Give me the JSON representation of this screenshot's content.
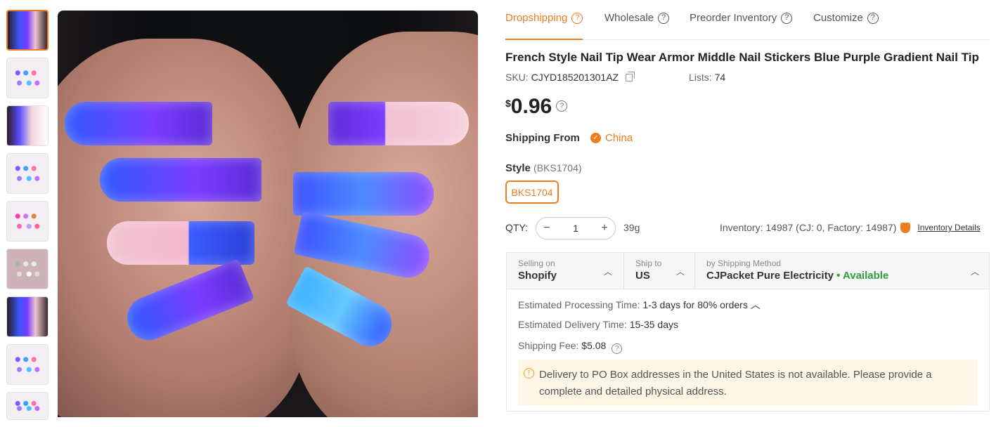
{
  "tabs": [
    {
      "label": "Dropshipping",
      "active": true
    },
    {
      "label": "Wholesale",
      "active": false
    },
    {
      "label": "Preorder Inventory",
      "active": false
    },
    {
      "label": "Customize",
      "active": false
    }
  ],
  "product": {
    "title": "French Style Nail Tip Wear Armor Middle Nail Stickers Blue Purple Gradient Nail Tip",
    "sku_label": "SKU:",
    "sku": "CJYD185201301AZ",
    "lists_label": "Lists:",
    "lists": "74",
    "currency": "$",
    "price": "0.96"
  },
  "shipping_from": {
    "label": "Shipping From",
    "value": "China"
  },
  "style": {
    "label": "Style",
    "selected": "(BKS1704)",
    "options": [
      "BKS1704"
    ]
  },
  "quantity": {
    "label": "QTY:",
    "value": "1",
    "weight": "39g"
  },
  "inventory": {
    "text": "Inventory: 14987 (CJ: 0, Factory: 14987)",
    "link": "Inventory Details"
  },
  "shipping": {
    "selling_on_label": "Selling on",
    "selling_on": "Shopify",
    "ship_to_label": "Ship to",
    "ship_to": "US",
    "method_label": "by Shipping Method",
    "method": "CJPacket Pure Electricity",
    "availability": "• Available",
    "processing_label": "Estimated Processing Time:",
    "processing": "1-3 days for 80% orders",
    "delivery_label": "Estimated Delivery Time:",
    "delivery": "15-35 days",
    "fee_label": "Shipping Fee:",
    "fee": "$5.08",
    "warning": "Delivery to PO Box addresses in the United States is not available. Please provide a complete and detailed physical address."
  },
  "colors": {
    "accent": "#f07c1e",
    "available": "#2e9e3f"
  }
}
